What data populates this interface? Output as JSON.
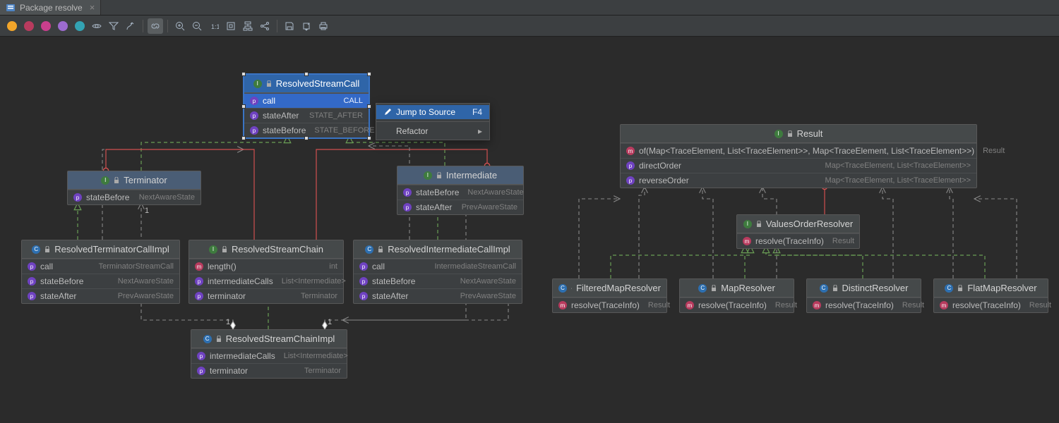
{
  "tab": {
    "title": "Package resolve"
  },
  "toolbar": {
    "filters": [
      "fields",
      "constructors",
      "methods",
      "properties",
      "inner-classes"
    ],
    "actions": [
      "visibility",
      "filter",
      "route",
      "link",
      "zoom-in",
      "zoom-out",
      "fit",
      "actual",
      "layout",
      "share",
      "save",
      "export",
      "print"
    ]
  },
  "context_menu": {
    "items": [
      {
        "label": "Jump to Source",
        "shortcut": "F4",
        "icon": "pencil"
      },
      {
        "label": "Refactor",
        "submenu": true
      }
    ]
  },
  "boxes": {
    "ResolvedStreamCall": {
      "title": "ResolvedStreamCall",
      "kind": "interface",
      "rows": [
        {
          "kind": "prop",
          "name": "call",
          "type": "CALL",
          "selected": true
        },
        {
          "kind": "prop",
          "name": "stateAfter",
          "type": "STATE_AFTER"
        },
        {
          "kind": "prop",
          "name": "stateBefore",
          "type": "STATE_BEFORE"
        }
      ]
    },
    "Terminator": {
      "title": "Terminator",
      "kind": "interface",
      "rows": [
        {
          "kind": "prop",
          "name": "stateBefore",
          "type": "NextAwareState"
        }
      ]
    },
    "Intermediate": {
      "title": "Intermediate",
      "kind": "interface",
      "rows": [
        {
          "kind": "prop",
          "name": "stateBefore",
          "type": "NextAwareState"
        },
        {
          "kind": "prop",
          "name": "stateAfter",
          "type": "PrevAwareState"
        }
      ]
    },
    "ResolvedTerminatorCallImpl": {
      "title": "ResolvedTerminatorCallImpl",
      "kind": "class",
      "rows": [
        {
          "kind": "prop",
          "name": "call",
          "type": "TerminatorStreamCall"
        },
        {
          "kind": "prop",
          "name": "stateBefore",
          "type": "NextAwareState"
        },
        {
          "kind": "prop",
          "name": "stateAfter",
          "type": "PrevAwareState"
        }
      ]
    },
    "ResolvedStreamChain": {
      "title": "ResolvedStreamChain",
      "kind": "interface",
      "rows": [
        {
          "kind": "meth",
          "name": "length()",
          "type": "int"
        },
        {
          "kind": "prop",
          "name": "intermediateCalls",
          "type": "List<Intermediate>"
        },
        {
          "kind": "prop",
          "name": "terminator",
          "type": "Terminator"
        }
      ]
    },
    "ResolvedIntermediateCallImpl": {
      "title": "ResolvedIntermediateCallImpl",
      "kind": "class",
      "rows": [
        {
          "kind": "prop",
          "name": "call",
          "type": "IntermediateStreamCall"
        },
        {
          "kind": "prop",
          "name": "stateBefore",
          "type": "NextAwareState"
        },
        {
          "kind": "prop",
          "name": "stateAfter",
          "type": "PrevAwareState"
        }
      ]
    },
    "ResolvedStreamChainImpl": {
      "title": "ResolvedStreamChainImpl",
      "kind": "class",
      "rows": [
        {
          "kind": "prop",
          "name": "intermediateCalls",
          "type": "List<Intermediate>"
        },
        {
          "kind": "prop",
          "name": "terminator",
          "type": "Terminator"
        }
      ]
    },
    "Result": {
      "title": "Result",
      "kind": "interface",
      "rows": [
        {
          "kind": "meth",
          "name": "of(Map<TraceElement, List<TraceElement>>, Map<TraceElement, List<TraceElement>>)",
          "type": "Result"
        },
        {
          "kind": "prop",
          "name": "directOrder",
          "type": "Map<TraceElement, List<TraceElement>>"
        },
        {
          "kind": "prop",
          "name": "reverseOrder",
          "type": "Map<TraceElement, List<TraceElement>>"
        }
      ]
    },
    "ValuesOrderResolver": {
      "title": "ValuesOrderResolver",
      "kind": "interface",
      "rows": [
        {
          "kind": "meth",
          "name": "resolve(TraceInfo)",
          "type": "Result"
        }
      ]
    },
    "FilteredMapResolver": {
      "title": "FilteredMapResolver",
      "kind": "class",
      "rows": [
        {
          "kind": "meth",
          "name": "resolve(TraceInfo)",
          "type": "Result"
        }
      ]
    },
    "MapResolver": {
      "title": "MapResolver",
      "kind": "class",
      "rows": [
        {
          "kind": "meth",
          "name": "resolve(TraceInfo)",
          "type": "Result"
        }
      ]
    },
    "DistinctResolver": {
      "title": "DistinctResolver",
      "kind": "class",
      "rows": [
        {
          "kind": "meth",
          "name": "resolve(TraceInfo)",
          "type": "Result"
        }
      ]
    },
    "FlatMapResolver": {
      "title": "FlatMapResolver",
      "kind": "class",
      "rows": [
        {
          "kind": "meth",
          "name": "resolve(TraceInfo)",
          "type": "Result"
        }
      ]
    }
  },
  "multiplicities": {
    "one": "1"
  }
}
